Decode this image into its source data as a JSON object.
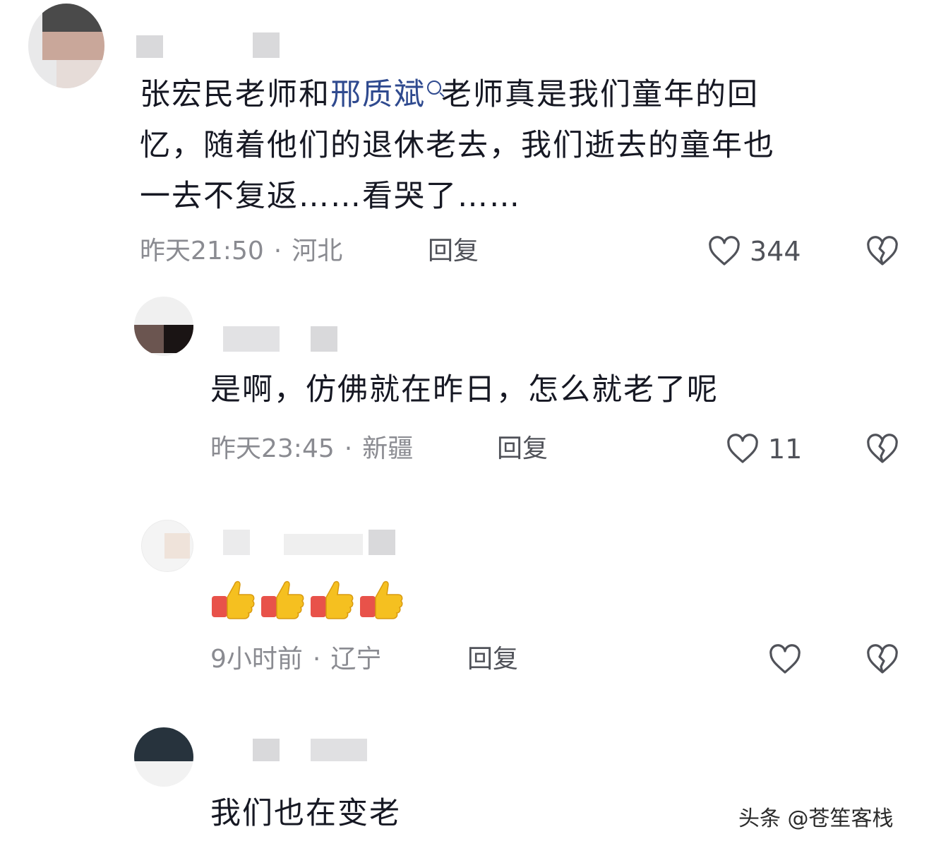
{
  "comments": [
    {
      "text_before": "张宏民老师和",
      "topic": "邢质斌",
      "text_after_line1": "老师真是我们童年的回",
      "line2": "忆，随着他们的退休老去，我们逝去的童年也",
      "line3": "一去不复返……看哭了……",
      "time": "昨天21:50",
      "location": "河北",
      "reply": "回复",
      "likes": "344"
    },
    {
      "text": "是啊，仿佛就在昨日，怎么就老了呢",
      "time": "昨天23:45",
      "location": "新疆",
      "reply": "回复",
      "likes": "11"
    },
    {
      "emoji": "thumbs-up-x4",
      "time": "9小时前",
      "location": "辽宁",
      "reply": "回复",
      "likes": ""
    },
    {
      "text": "我们也在变老"
    }
  ],
  "separator": "·",
  "watermark": "头条 @苍笙客栈",
  "colors": {
    "topic": "#2f4a8f",
    "meta": "#8a8b91",
    "thumb": "#f5c020",
    "cuff": "#e8524a"
  },
  "icons": [
    "heart-outline-icon",
    "broken-heart-icon",
    "search-icon",
    "thumbs-up-emoji"
  ]
}
